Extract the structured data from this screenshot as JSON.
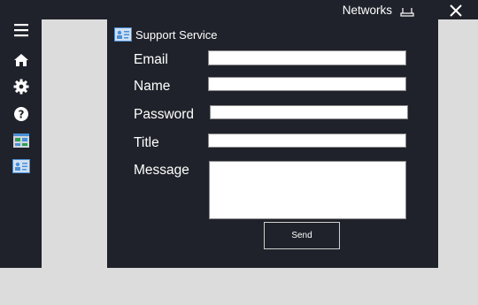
{
  "header": {
    "networks_label": "Networks",
    "icons": {
      "network": "network-icon",
      "close": "close-icon"
    }
  },
  "sidebar": {
    "items": [
      {
        "icon": "hamburger-menu-icon"
      },
      {
        "icon": "home-icon"
      },
      {
        "icon": "gear-icon"
      },
      {
        "icon": "help-icon"
      },
      {
        "icon": "dashboard-icon"
      },
      {
        "icon": "support-card-icon"
      }
    ]
  },
  "form": {
    "title": "Support Service",
    "title_icon": "support-card-icon",
    "fields": {
      "email": {
        "label": "Email",
        "value": ""
      },
      "name": {
        "label": "Name",
        "value": ""
      },
      "password": {
        "label": "Password",
        "value": ""
      },
      "title": {
        "label": "Title",
        "value": ""
      },
      "message": {
        "label": "Message",
        "value": ""
      }
    },
    "send_label": "Send"
  },
  "colors": {
    "background": "#dcdcdc",
    "panel": "#1f222a",
    "text": "#ffffff",
    "icon_accent": "#4a8fd6"
  }
}
